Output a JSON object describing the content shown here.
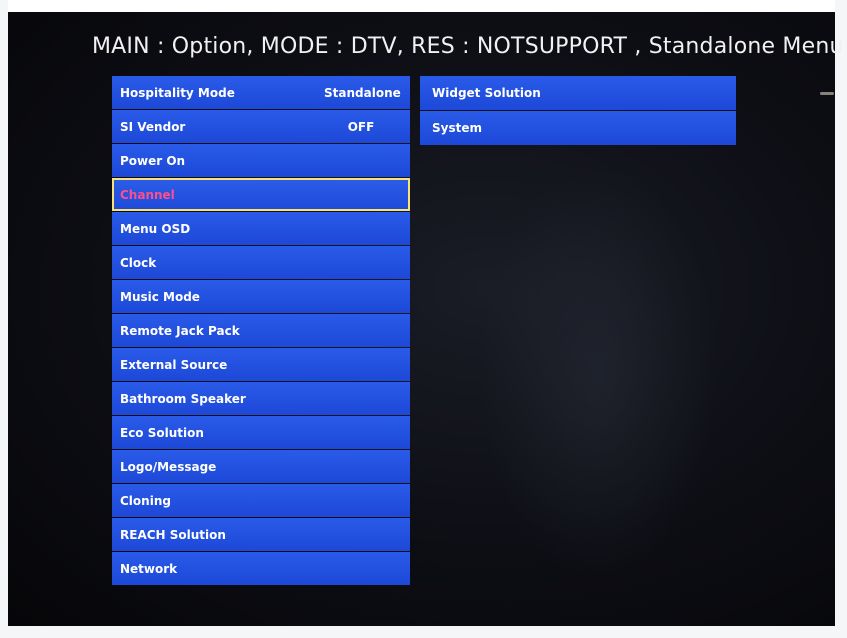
{
  "header": {
    "title": "MAIN : Option, MODE : DTV, RES : NOTSUPPORT , Standalone Menu"
  },
  "menu": {
    "items": [
      {
        "label": "Hospitality Mode",
        "value": "Standalone"
      },
      {
        "label": "SI Vendor",
        "value": "OFF"
      },
      {
        "label": "Power On",
        "value": ""
      },
      {
        "label": "Channel",
        "value": "",
        "selected": true
      },
      {
        "label": "Menu OSD",
        "value": ""
      },
      {
        "label": "Clock",
        "value": ""
      },
      {
        "label": "Music Mode",
        "value": ""
      },
      {
        "label": "Remote Jack Pack",
        "value": ""
      },
      {
        "label": "External Source",
        "value": ""
      },
      {
        "label": "Bathroom Speaker",
        "value": ""
      },
      {
        "label": "Eco Solution",
        "value": ""
      },
      {
        "label": "Logo/Message",
        "value": ""
      },
      {
        "label": "Cloning",
        "value": ""
      },
      {
        "label": "REACH Solution",
        "value": ""
      },
      {
        "label": "Network",
        "value": ""
      }
    ]
  },
  "submenu": {
    "items": [
      {
        "label": "Widget Solution"
      },
      {
        "label": "System"
      }
    ]
  },
  "colors": {
    "menu_blue": "#2a5be8",
    "selected_outline": "#f7e37a",
    "selected_text": "#ff4f8a",
    "title_text": "#f1f1f1"
  }
}
